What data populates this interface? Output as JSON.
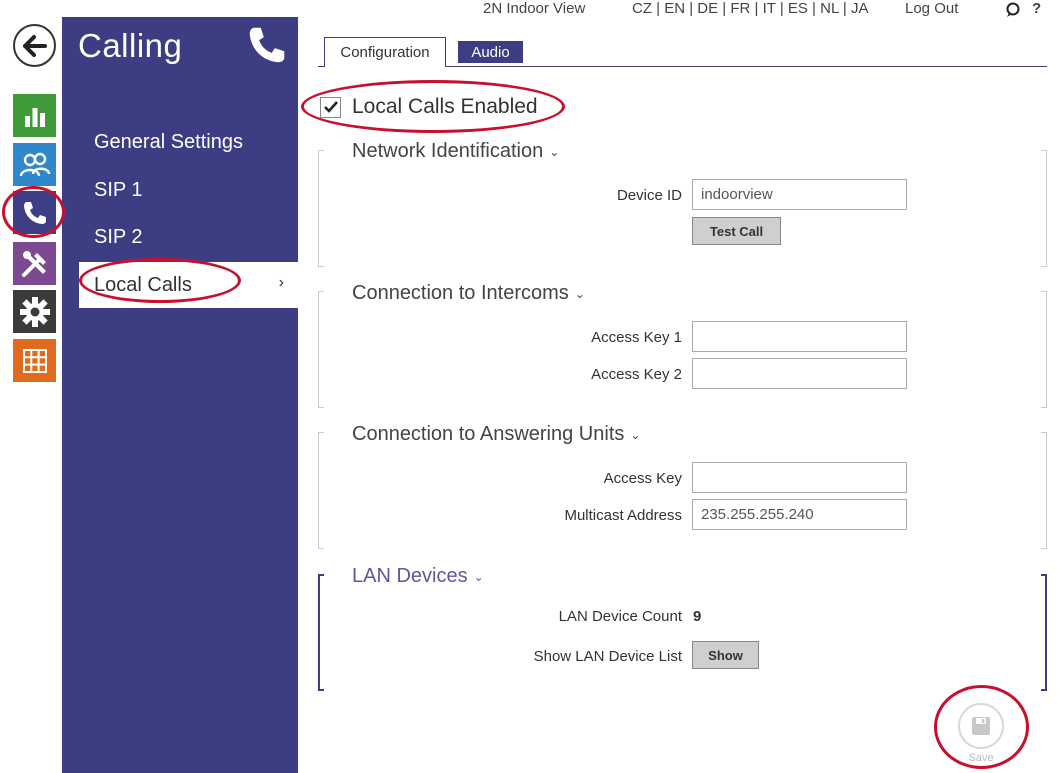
{
  "topbar": {
    "device_name": "2N Indoor View",
    "languages": "CZ | EN | DE | FR | IT | ES | NL | JA",
    "logout": "Log Out",
    "help_mark": "?"
  },
  "rail": {
    "items": [
      {
        "icon": "back-arrow-icon"
      },
      {
        "icon": "status-chart-icon",
        "color": "#3f9a3a"
      },
      {
        "icon": "directory-users-icon",
        "color": "#2f88c9"
      },
      {
        "icon": "calling-phone-icon",
        "color": "#3d3e86"
      },
      {
        "icon": "services-tools-icon",
        "color": "#7d4a91"
      },
      {
        "icon": "hardware-gear-icon",
        "color": "#3b3b3b"
      },
      {
        "icon": "system-grid-icon",
        "color": "#e06a1e"
      }
    ]
  },
  "sidemenu": {
    "title": "Calling",
    "items": [
      {
        "label": "General Settings"
      },
      {
        "label": "SIP 1"
      },
      {
        "label": "SIP 2"
      },
      {
        "label": "Local Calls",
        "active": true
      }
    ],
    "active_arrow": "›"
  },
  "tabs": [
    {
      "label": "Configuration",
      "active": true
    },
    {
      "label": "Audio",
      "active": false
    }
  ],
  "enable": {
    "label": "Local Calls Enabled",
    "checked": true
  },
  "network": {
    "title": "Network Identification",
    "device_id_label": "Device ID",
    "device_id_value": "indoorview",
    "test_call_label": "Test Call"
  },
  "intercoms": {
    "title": "Connection to Intercoms",
    "key1_label": "Access Key 1",
    "key1_value": "",
    "key2_label": "Access Key 2",
    "key2_value": ""
  },
  "answering": {
    "title": "Connection to Answering Units",
    "key_label": "Access Key",
    "key_value": "",
    "multicast_label": "Multicast Address",
    "multicast_value": "235.255.255.240"
  },
  "lan": {
    "title": "LAN Devices",
    "count_label": "LAN Device Count",
    "count_value": "9",
    "list_label": "Show LAN Device List",
    "show_label": "Show"
  },
  "save": {
    "label": "Save"
  },
  "colors": {
    "brand": "#3d3d84",
    "annotation": "#c8102e"
  }
}
